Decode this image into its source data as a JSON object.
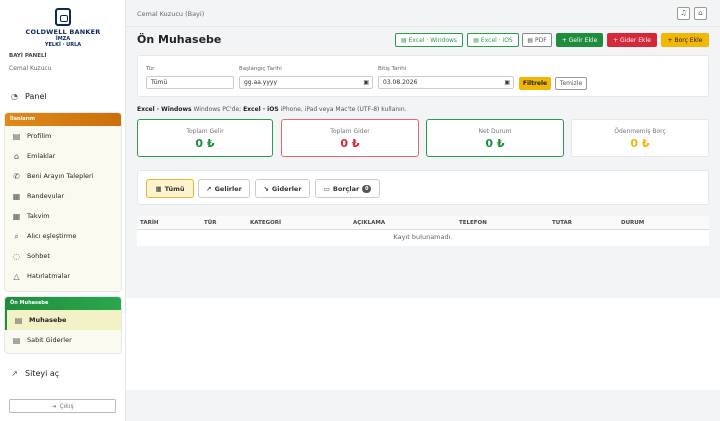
{
  "brand": {
    "line1": "COLDWELL BANKER",
    "line2": "İMZA",
    "line3": "YELKİ · URLA",
    "panel_label": "BAYİ PANELİ",
    "user": "Cemal Kuzucu"
  },
  "nav": {
    "panel": "Panel",
    "group1_title": "İlanlarım",
    "group1_items": [
      "Profilim",
      "Emlaklar",
      "Beni Arayın Talepleri",
      "Randevular",
      "Takvim",
      "Alıcı eşleştirme",
      "Sohbet",
      "Hatırlatmalar"
    ],
    "group2_title": "Ön Muhasebe",
    "group2_items": [
      "Muhasebe",
      "Sabit Giderler"
    ],
    "site_link": "Siteyi aç",
    "logout": "Çıkış"
  },
  "topbar": {
    "user_label": "Cemal Kuzucu (Bayi)"
  },
  "page": {
    "title": "Ön Muhasebe",
    "buttons": {
      "excel_windows": "Excel · Windows",
      "excel_ios": "Excel · iOS",
      "pdf": "PDF",
      "add_income": "+ Gelir Ekle",
      "add_expense": "+ Gider Ekle",
      "add_debt": "+ Borç Ekle"
    }
  },
  "filters": {
    "type_label": "Tür",
    "type_value": "Tümü",
    "start_label": "Başlangıç Tarihi",
    "start_placeholder": "gg.aa.yyyy",
    "end_label": "Bitiş Tarihi",
    "end_value": "03.08.2026",
    "filter_btn": "Filtrele",
    "clear_btn": "Temizle"
  },
  "note": {
    "w_bold": "Excel · Windows",
    "w_text": " Windows PC'de; ",
    "i_bold": "Excel · iOS",
    "i_text": " iPhone, iPad veya Mac'te (UTF-8) kullanın."
  },
  "stats": [
    {
      "label": "Toplam Gelir",
      "value": "0 ₺"
    },
    {
      "label": "Toplam Gider",
      "value": "0 ₺"
    },
    {
      "label": "Net Durum",
      "value": "0 ₺"
    },
    {
      "label": "Ödenmemiş Borç",
      "value": "0 ₺"
    }
  ],
  "tabs": {
    "all": "Tümü",
    "income": "Gelirler",
    "expense": "Giderler",
    "debts": "Borçlar",
    "debts_count": "0"
  },
  "table": {
    "headers": [
      "TARİH",
      "TÜR",
      "KATEGORİ",
      "AÇIKLAMA",
      "TELEFON",
      "TUTAR",
      "DURUM"
    ],
    "empty": "Kayıt bulunamadı."
  },
  "colors": {
    "green": "#1f8d3d",
    "red": "#d62839",
    "yellow": "#f2b705",
    "orange": "#e08a18"
  }
}
